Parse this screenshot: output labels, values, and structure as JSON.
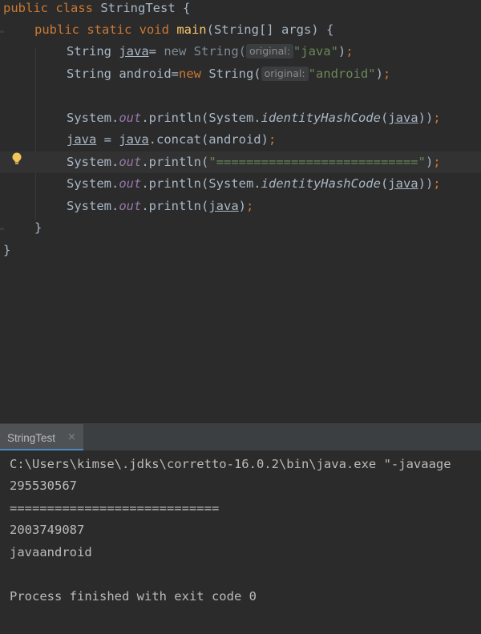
{
  "editor": {
    "lines": [
      {
        "t": "class_decl",
        "parts": [
          "public ",
          "class ",
          "StringTest {"
        ]
      },
      {
        "t": "method_decl",
        "parts": [
          "public static void ",
          "main",
          "(String[] args) {"
        ]
      },
      {
        "t": "java_decl",
        "parts": [
          "String ",
          "java",
          "= ",
          "new ",
          "String(",
          "original:",
          "\"java\"",
          ");"
        ]
      },
      {
        "t": "android_decl",
        "parts": [
          "String android=",
          "new ",
          "String(",
          "original:",
          "\"android\"",
          ");"
        ]
      },
      {
        "t": "println1",
        "parts": [
          "System.",
          "out",
          ".println(System.",
          "identityHashCode",
          "(",
          "java",
          "));"
        ]
      },
      {
        "t": "concat",
        "parts": [
          "java",
          " = ",
          "java",
          ".concat(android)",
          ";"
        ]
      },
      {
        "t": "println_sep",
        "parts": [
          "System.",
          "out",
          ".println(",
          "\"===========================\"",
          ");"
        ]
      },
      {
        "t": "println2",
        "parts": [
          "System.",
          "out",
          ".println(System.",
          "identityHashCode",
          "(",
          "java",
          "));"
        ]
      },
      {
        "t": "println3",
        "parts": [
          "System.",
          "out",
          ".println(",
          "java",
          ");"
        ]
      },
      {
        "t": "close_method",
        "parts": [
          "}"
        ]
      },
      {
        "t": "close_class",
        "parts": [
          "}"
        ]
      }
    ]
  },
  "run_panel": {
    "tab_label": "StringTest",
    "close_glyph": "×",
    "output": [
      "C:\\Users\\kimse\\.jdks\\corretto-16.0.2\\bin\\java.exe \"-javaage",
      "295530567",
      "============================",
      "2003749087",
      "javaandroid",
      "",
      "Process finished with exit code 0"
    ]
  },
  "colors": {
    "keyword": "#cc7832",
    "method": "#ffc66d",
    "string": "#6a8759",
    "field": "#9876aa",
    "default_text": "#a9b7c6",
    "background": "#2b2b2b"
  }
}
